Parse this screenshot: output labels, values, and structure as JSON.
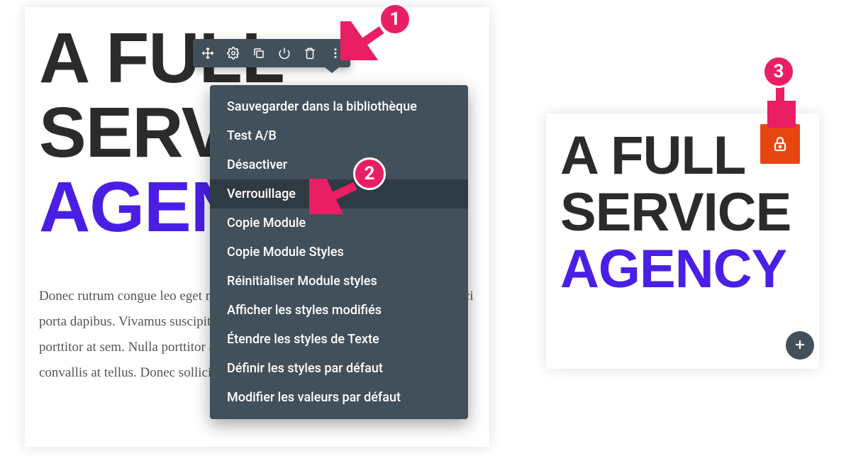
{
  "left": {
    "heading_line1": "A FULL",
    "heading_line2": "SERVICE",
    "heading_accent": "AGENCY",
    "lorem": "Donec rutrum congue leo eget malesuada. Sed porttitor lectus nibh ipsum id orci porta dapibus. Vivamus suscipit tortor eget felis porttitor id imperdiet et, porttitor at sem. Nulla porttitor accumsan tincidunt. eget consectetur sed, convallis at tellus. Donec sollicitudin molestie a sit"
  },
  "toolbar": {
    "icons": [
      {
        "name": "move-icon"
      },
      {
        "name": "gear-icon"
      },
      {
        "name": "duplicate-icon"
      },
      {
        "name": "power-icon"
      },
      {
        "name": "trash-icon"
      },
      {
        "name": "more-vertical-icon"
      }
    ]
  },
  "menu": {
    "items": [
      {
        "label": "Sauvegarder dans la bibliothèque"
      },
      {
        "label": "Test A/B"
      },
      {
        "label": "Désactiver"
      },
      {
        "label": "Verrouillage",
        "highlighted": true
      },
      {
        "label": "Copie Module"
      },
      {
        "label": "Copie Module Styles"
      },
      {
        "label": "Réinitialiser Module styles"
      },
      {
        "label": "Afficher les styles modifiés"
      },
      {
        "label": "Étendre les styles de Texte"
      },
      {
        "label": "Définir les styles par défaut"
      },
      {
        "label": "Modifier les valeurs par défaut"
      }
    ]
  },
  "right": {
    "heading_line1": "A FULL",
    "heading_line2": "SERVICE",
    "heading_accent": "AGENCY"
  },
  "callouts": {
    "c1": "1",
    "c2": "2",
    "c3": "3"
  }
}
